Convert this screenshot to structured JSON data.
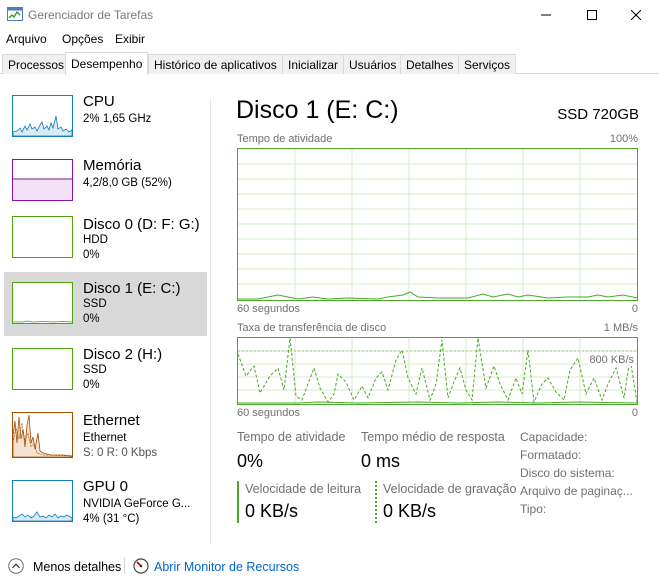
{
  "window": {
    "title": "Gerenciador de Tarefas"
  },
  "menu": [
    "Arquivo",
    "Opções",
    "Exibir"
  ],
  "tabs": [
    {
      "label": "Processos",
      "active": false
    },
    {
      "label": "Desempenho",
      "active": true
    },
    {
      "label": "Histórico de aplicativos",
      "active": false
    },
    {
      "label": "Inicializar",
      "active": false
    },
    {
      "label": "Usuários",
      "active": false
    },
    {
      "label": "Detalhes",
      "active": false
    },
    {
      "label": "Serviços",
      "active": false
    }
  ],
  "sidebar": {
    "items": [
      {
        "name": "CPU",
        "line1": "2% 1,65 GHz",
        "line2": "",
        "selected": false,
        "color": "#117dbb"
      },
      {
        "name": "Memória",
        "line1": "4,2/8,0 GB (52%)",
        "line2": "",
        "selected": false,
        "color": "#8b12ae"
      },
      {
        "name": "Disco 0 (D: F: G:)",
        "line1": "HDD",
        "line2": "0%",
        "selected": false,
        "color": "#4da60c"
      },
      {
        "name": "Disco 1 (E: C:)",
        "line1": "SSD",
        "line2": "0%",
        "selected": true,
        "color": "#4da60c"
      },
      {
        "name": "Disco 2 (H:)",
        "line1": "SSD",
        "line2": "0%",
        "selected": false,
        "color": "#4da60c"
      },
      {
        "name": "Ethernet",
        "line1": "Ethernet",
        "line2": "S: 0 R: 0 Kbps",
        "selected": false,
        "color": "#a74f01"
      },
      {
        "name": "GPU 0",
        "line1": "NVIDIA GeForce G...",
        "line2": "4% (31 °C)",
        "selected": false,
        "color": "#117dbb"
      }
    ]
  },
  "main": {
    "title": "Disco 1 (E: C:)",
    "model": "SSD 720GB",
    "graph1": {
      "label": "Tempo de atividade",
      "max": "100%",
      "time": "60 segundos",
      "min": "0"
    },
    "graph2": {
      "label": "Taxa de transferência de disco",
      "max": "1 MB/s",
      "mid": "800 KB/s",
      "time": "60 segundos",
      "min": "0"
    },
    "stats": {
      "active_time_label": "Tempo de atividade",
      "active_time_value": "0%",
      "response_label": "Tempo médio de resposta",
      "response_value": "0 ms",
      "read_label": "Velocidade de leitura",
      "read_value": "0 KB/s",
      "write_label": "Velocidade de gravação",
      "write_value": "0 KB/s"
    },
    "properties": [
      "Capacidade:",
      "Formatado:",
      "Disco do sistema:",
      "Arquivo de paginaç...",
      "Tipo:"
    ]
  },
  "footer": {
    "less_details": "Menos detalhes",
    "resource_monitor": "Abrir Monitor de Recursos"
  },
  "colors": {
    "disk_green": "#4aa828",
    "selected_bg": "#d9d9d9",
    "link_blue": "#0066cc"
  }
}
